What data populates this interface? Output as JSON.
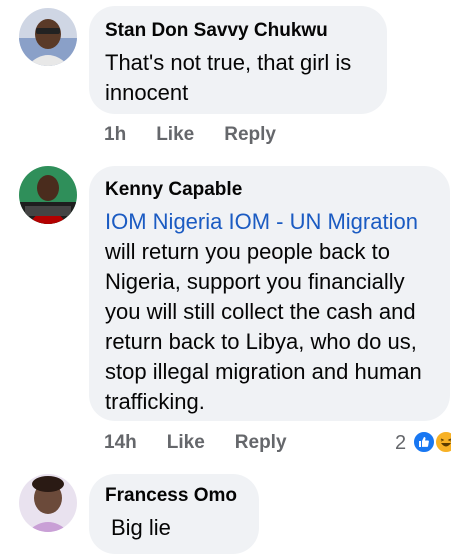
{
  "comments": [
    {
      "author": "Stan Don Savvy Chukwu",
      "text": "That's not true, that girl is innocent",
      "time": "1h",
      "like_label": "Like",
      "reply_label": "Reply",
      "avatar_icon": "profile-photo"
    },
    {
      "author": "Kenny Capable",
      "mention": "IOM Nigeria IOM - UN Migration",
      "text": "will return you people back to Nigeria, support you financially you will still collect the cash and return back to Libya,  who do us,  stop illegal migration and human trafficking.",
      "time": "14h",
      "like_label": "Like",
      "reply_label": "Reply",
      "reaction_count": "2",
      "reactions": [
        "like-icon",
        "haha-icon"
      ],
      "avatar_icon": "profile-photo"
    },
    {
      "author": "Francess Omo",
      "text": "Big lie",
      "avatar_icon": "profile-photo"
    }
  ],
  "colors": {
    "bubble": "#f0f2f5",
    "mention": "#1b5bc2",
    "meta": "#65676b",
    "like": "#1877f2",
    "haha": "#f7b125"
  }
}
